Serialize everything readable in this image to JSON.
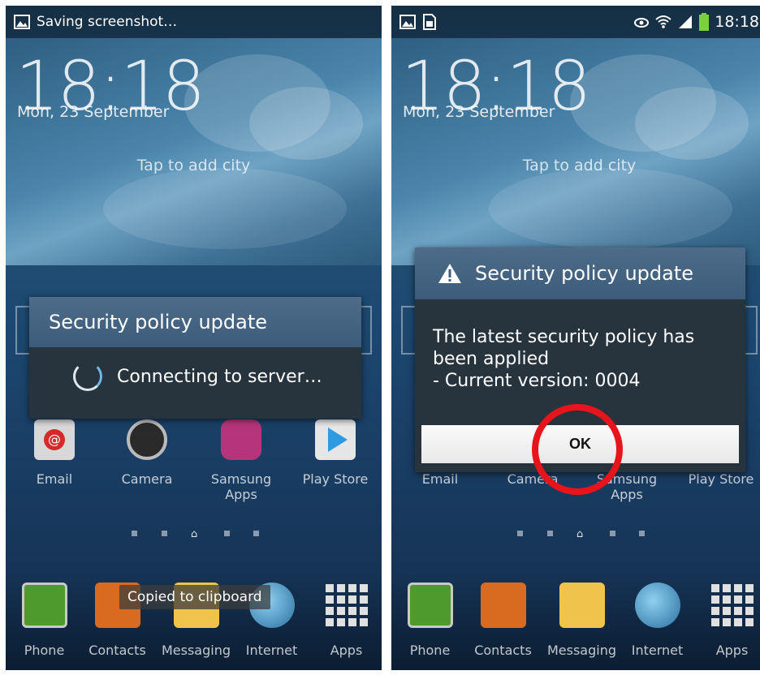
{
  "left_screen": {
    "status": {
      "text": "Saving screenshot…",
      "icon": "image-icon"
    },
    "clock": "18:18",
    "date": "Mon, 23 September",
    "weather": "Tap to add city",
    "dialog": {
      "title": "Security policy update",
      "message": "Connecting to server…"
    },
    "apps": [
      "Email",
      "Camera",
      "Samsung Apps",
      "Play Store"
    ],
    "dock": [
      "Phone",
      "Contacts",
      "Messaging",
      "Internet",
      "Apps"
    ],
    "toast": "Copied to clipboard"
  },
  "right_screen": {
    "status": {
      "time": "18:18"
    },
    "clock": "18:18",
    "date": "Mon, 23 September",
    "weather": "Tap to add city",
    "dialog": {
      "title": "Security policy update",
      "message_line1": "The latest security policy has",
      "message_line2": "been applied",
      "message_line3": "- Current version: 0004",
      "ok_label": "OK"
    },
    "apps": [
      "Email",
      "Camera",
      "Samsung Apps",
      "Play Store"
    ],
    "dock": [
      "Phone",
      "Contacts",
      "Messaging",
      "Internet",
      "Apps"
    ]
  },
  "colors": {
    "highlight_circle": "#e8141b",
    "dialog_header": "#4d6c89",
    "dialog_body": "#27333d"
  }
}
